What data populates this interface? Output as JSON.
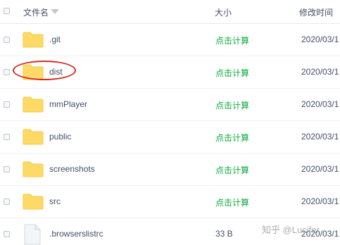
{
  "header": {
    "name_label": "文件名",
    "size_label": "大小",
    "time_label": "修改时间"
  },
  "rows": [
    {
      "name": ".git",
      "type": "folder",
      "size": "点击计算",
      "time": "2020/03/1"
    },
    {
      "name": "dist",
      "type": "folder",
      "size": "点击计算",
      "time": "2020/03/1"
    },
    {
      "name": "mmPlayer",
      "type": "folder",
      "size": "点击计算",
      "time": "2020/03/1"
    },
    {
      "name": "public",
      "type": "folder",
      "size": "点击计算",
      "time": "2020/03/1"
    },
    {
      "name": "screenshots",
      "type": "folder",
      "size": "点击计算",
      "time": "2020/03/1"
    },
    {
      "name": "src",
      "type": "folder",
      "size": "点击计算",
      "time": "2020/03/1"
    },
    {
      "name": ".browserslistrc",
      "type": "file",
      "size": "33 B",
      "time": "2020/03/1"
    }
  ],
  "watermark": "知乎 @Lucifer",
  "colors": {
    "folder": "#fdd966",
    "folder_dark": "#f5c945",
    "size_link": "#09aa3d",
    "highlight": "#d92b1f"
  }
}
